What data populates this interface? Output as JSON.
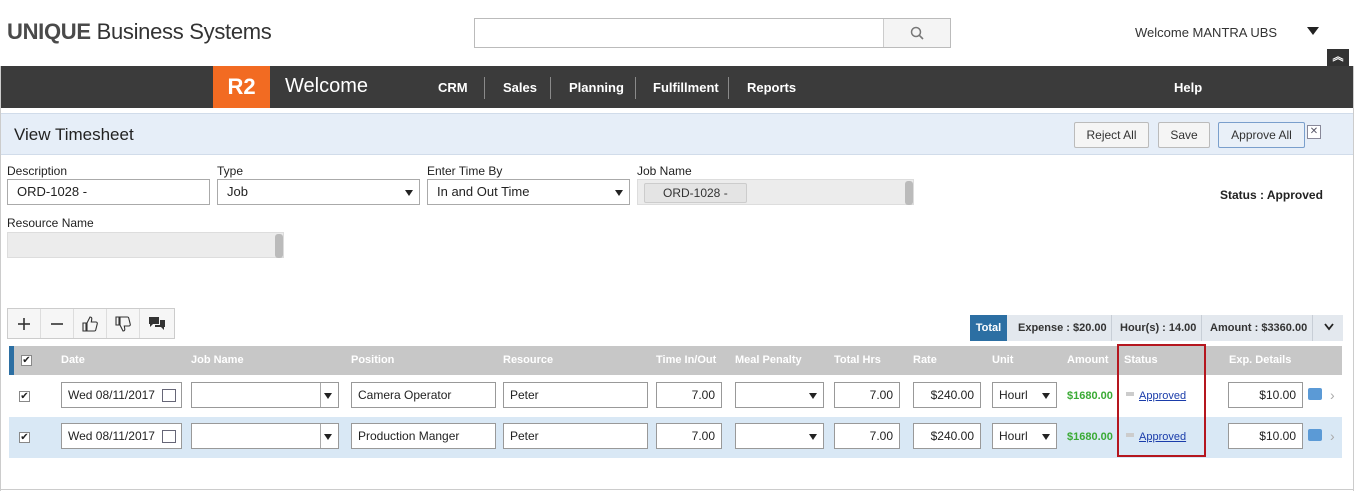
{
  "brand": {
    "bold": "UNIQUE",
    "rest": " Business Systems"
  },
  "search": {
    "placeholder": ""
  },
  "user": {
    "welcome": "Welcome MANTRA UBS"
  },
  "nav": {
    "logo": "R2",
    "title": "Welcome",
    "items": [
      "CRM",
      "Sales",
      "Planning",
      "Fulfillment",
      "Reports"
    ],
    "help": "Help"
  },
  "page": {
    "title": "View Timesheet",
    "buttons": {
      "reject_all": "Reject All",
      "save": "Save",
      "approve_all": "Approve All"
    }
  },
  "form": {
    "description": {
      "label": "Description",
      "value": "ORD-1028 -"
    },
    "type": {
      "label": "Type",
      "value": "Job"
    },
    "enter_time_by": {
      "label": "Enter Time By",
      "value": "In and Out Time"
    },
    "job_name": {
      "label": "Job Name",
      "value": "ORD-1028 -"
    },
    "resource_name": {
      "label": "Resource Name",
      "value": ""
    },
    "status": "Status : Approved"
  },
  "summary": {
    "total": "Total",
    "expense": "Expense : $20.00",
    "hours": "Hour(s) : 14.00",
    "amount": "Amount : $3360.00"
  },
  "grid": {
    "headers": [
      "Date",
      "Job Name",
      "Position",
      "Resource",
      "Time In/Out",
      "Meal Penalty",
      "Total Hrs",
      "Rate",
      "Unit",
      "Amount",
      "Status",
      "Exp. Details"
    ],
    "rows": [
      {
        "date": "Wed 08/11/2017",
        "job_name": "",
        "position": "Camera Operator",
        "resource": "Peter",
        "time": "7.00",
        "meal": "",
        "total_hrs": "7.00",
        "rate": "$240.00",
        "unit": "Hourl",
        "amount": "$1680.00",
        "status": "Approved",
        "exp": "$10.00"
      },
      {
        "date": "Wed 08/11/2017",
        "job_name": "",
        "position": "Production Manger",
        "resource": "Peter",
        "time": "7.00",
        "meal": "",
        "total_hrs": "7.00",
        "rate": "$240.00",
        "unit": "Hourl",
        "amount": "$1680.00",
        "status": "Approved",
        "exp": "$10.00"
      }
    ]
  },
  "colors": {
    "accent": "#f26b22",
    "nav": "#3b3b3b",
    "primary": "#2c6fa3",
    "amount": "#3aaa35",
    "highlight": "#b5161e"
  }
}
